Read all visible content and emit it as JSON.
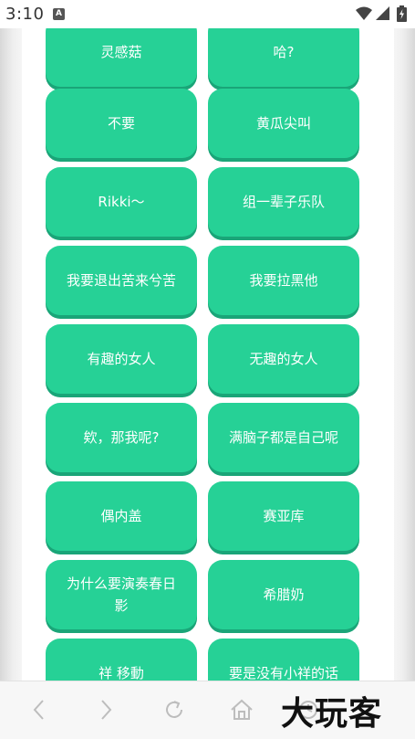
{
  "status_bar": {
    "time": "3:10",
    "notification_badge": "A",
    "wifi_icon": "wifi-icon",
    "signal_icon": "signal-icon",
    "battery_icon": "battery-charging-icon"
  },
  "buttons": [
    {
      "label": "灵感菇"
    },
    {
      "label": "哈?"
    },
    {
      "label": "不要"
    },
    {
      "label": "黄瓜尖叫"
    },
    {
      "label": "Rikki～"
    },
    {
      "label": "组一辈子乐队"
    },
    {
      "label": "我要退出苦来兮苦"
    },
    {
      "label": "我要拉黑他"
    },
    {
      "label": "有趣的女人"
    },
    {
      "label": "无趣的女人"
    },
    {
      "label": "欸，那我呢?"
    },
    {
      "label": "满脑子都是自己呢"
    },
    {
      "label": "偶内盖"
    },
    {
      "label": "赛亚库"
    },
    {
      "label": "为什么要演奏春日影"
    },
    {
      "label": "希腊奶"
    },
    {
      "label": "祥 移動"
    },
    {
      "label": "要是没有小祥的话"
    }
  ],
  "colors": {
    "button": "#26d196",
    "button_shadow": "#1aa578",
    "button_text": "#ffffff"
  },
  "browser_bar": {
    "icons": [
      "back-icon",
      "forward-icon",
      "reload-icon",
      "home-icon",
      "history-icon"
    ],
    "watermark": "大玩客"
  }
}
